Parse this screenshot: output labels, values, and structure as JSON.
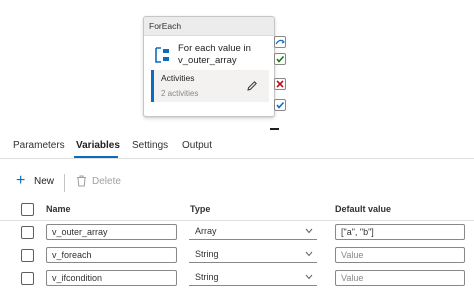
{
  "activity": {
    "header": "ForEach",
    "title": "For each value in v_outer_array",
    "activities_label": "Activities",
    "activities_count": "2 activities"
  },
  "tabs": [
    {
      "label": "Parameters"
    },
    {
      "label": "Variables"
    },
    {
      "label": "Settings"
    },
    {
      "label": "Output"
    }
  ],
  "active_tab": "Variables",
  "toolbar": {
    "new_label": "New",
    "delete_label": "Delete"
  },
  "table": {
    "headers": {
      "name": "Name",
      "type": "Type",
      "default": "Default value"
    },
    "rows": [
      {
        "name": "v_outer_array",
        "type": "Array",
        "default": "[\"a\", \"b\"]",
        "default_is_placeholder": false
      },
      {
        "name": "v_foreach",
        "type": "String",
        "default": "Value",
        "default_is_placeholder": true
      },
      {
        "name": "v_ifcondition",
        "type": "String",
        "default": "Value",
        "default_is_placeholder": true
      }
    ]
  },
  "colors": {
    "accent": "#0f6cbd",
    "success": "#107c10",
    "error": "#c50f1f"
  }
}
